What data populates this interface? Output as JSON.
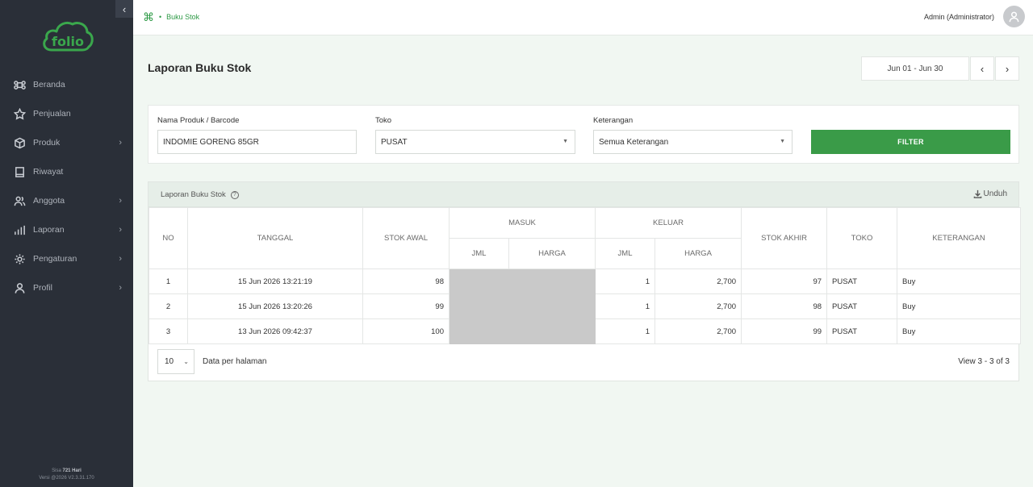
{
  "sidebar": {
    "collapse_icon": "‹",
    "logo_text": "folio",
    "items": [
      {
        "label": "Beranda",
        "icon": "command-icon",
        "has_submenu": false
      },
      {
        "label": "Penjualan",
        "icon": "star-icon",
        "has_submenu": false
      },
      {
        "label": "Produk",
        "icon": "box-icon",
        "has_submenu": true
      },
      {
        "label": "Riwayat",
        "icon": "book-icon",
        "has_submenu": false
      },
      {
        "label": "Anggota",
        "icon": "users-icon",
        "has_submenu": true
      },
      {
        "label": "Laporan",
        "icon": "chart-icon",
        "has_submenu": true
      },
      {
        "label": "Pengaturan",
        "icon": "settings-icon",
        "has_submenu": true
      },
      {
        "label": "Profil",
        "icon": "user-icon",
        "has_submenu": true
      }
    ],
    "footer_line1_prefix": "Sisa",
    "footer_line1_value": "721 Hari",
    "footer_line2": "Versi @2026 V2.3.31.170"
  },
  "topbar": {
    "breadcrumb_icon": "⌘",
    "breadcrumb_separator": "•",
    "breadcrumb_current": "Buku Stok",
    "user_name": "Admin (Administrator)"
  },
  "page": {
    "title": "Laporan Buku Stok",
    "date_range": "Jun 01 - Jun 30",
    "prev_label": "‹",
    "next_label": "›"
  },
  "filters": {
    "product_label": "Nama Produk / Barcode",
    "product_value": "INDOMIE GORENG 85GR",
    "store_label": "Toko",
    "store_value": "PUSAT",
    "note_label": "Keterangan",
    "note_value": "Semua Keterangan",
    "button_label": "FILTER"
  },
  "report": {
    "title": "Laporan Buku Stok",
    "help_icon": "?",
    "download_label": "Unduh",
    "headers": {
      "no": "NO",
      "date": "TANGGAL",
      "opening": "STOK AWAL",
      "in": "MASUK",
      "out": "KELUAR",
      "closing": "STOK AKHIR",
      "store": "TOKO",
      "note": "KETERANGAN",
      "qty": "JML",
      "price": "HARGA"
    },
    "rows": [
      {
        "no": "1",
        "date": "15 Jun 2026 13:21:19",
        "opening": "98",
        "in_qty": "",
        "in_price": "",
        "out_qty": "1",
        "out_price": "2,700",
        "closing": "97",
        "store": "PUSAT",
        "note": "Buy"
      },
      {
        "no": "2",
        "date": "15 Jun 2026 13:20:26",
        "opening": "99",
        "in_qty": "",
        "in_price": "",
        "out_qty": "1",
        "out_price": "2,700",
        "closing": "98",
        "store": "PUSAT",
        "note": "Buy"
      },
      {
        "no": "3",
        "date": "13 Jun 2026 09:42:37",
        "opening": "100",
        "in_qty": "",
        "in_price": "",
        "out_qty": "1",
        "out_price": "2,700",
        "closing": "99",
        "store": "PUSAT",
        "note": "Buy"
      }
    ],
    "page_size": "10",
    "per_page_label": "Data per halaman",
    "view_count": "View 3 - 3 of 3"
  },
  "colors": {
    "brand_green": "#3a9b48",
    "sidebar_bg": "#2a2f38",
    "page_bg": "#f1f7f2"
  }
}
